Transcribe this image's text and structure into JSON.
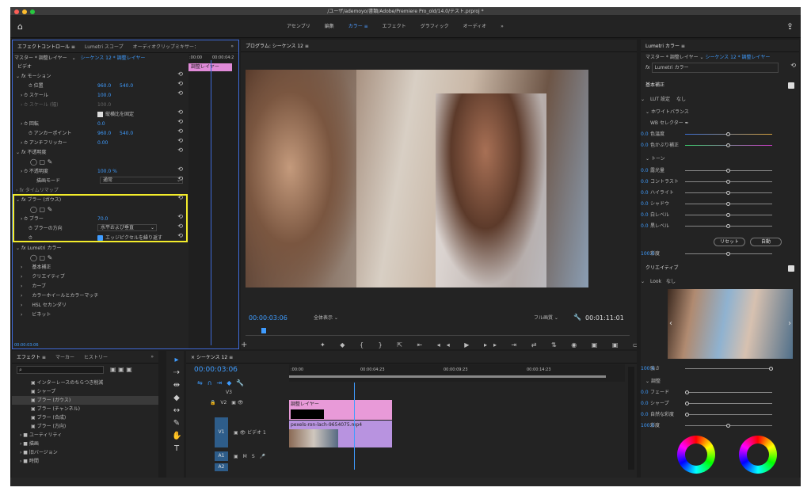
{
  "window": {
    "title": "/ユーザ/ademoyo/書類/Adobe/Premiere Pro_old/14.0/テスト.prproj *"
  },
  "workspace": {
    "tabs": [
      "アセンブリ",
      "編集",
      "カラー",
      "エフェクト",
      "グラフィック",
      "オーディオ"
    ],
    "active": "カラー",
    "more": "»"
  },
  "effect_controls": {
    "tabs": [
      "エフェクトコントロール",
      "Lumetri スコープ",
      "オーディオクリップミキサー："
    ],
    "header": {
      "master": "マスター * 調整レイヤー",
      "seq": "シーケンス 12 * 調整レイヤー",
      "time_start": ":00:00",
      "time_end": "00:00:04:2",
      "clip_label": "調整レイヤー"
    },
    "video_label": "ビデオ",
    "motion": {
      "name": "モーション",
      "pos_label": "位置",
      "pos_x": "960.0",
      "pos_y": "540.0",
      "scale_label": "スケール",
      "scale": "100.0",
      "scalew_label": "スケール (幅)",
      "lock_label": "縦横比を固定",
      "rot_label": "回転",
      "rot": "0.0",
      "anchor_label": "アンカーポイント",
      "anc_x": "960.0",
      "anc_y": "540.0",
      "flicker_label": "アンチフリッカー",
      "flicker": "0.00"
    },
    "opacity": {
      "name": "不透明度",
      "label": "不透明度",
      "value": "100.0 %",
      "blend_label": "描画モード",
      "blend": "通常"
    },
    "remap": "タイムリマップ",
    "blur": {
      "name": "ブラー (ガウス)",
      "label": "ブラー",
      "value": "70.0",
      "dir_label": "ブラーの方向",
      "dir": "水平および垂直",
      "repeat": "エッジピクセルを繰り返す"
    },
    "lumetri": {
      "name": "Lumetri カラー",
      "items": [
        "基本補正",
        "クリエイティブ",
        "カーブ",
        "カラーホイールとカラーマッチ",
        "HSL セカンダリ",
        "ビネット"
      ]
    },
    "timecode": "00:00:03:06"
  },
  "program": {
    "title": "プログラム: シーケンス 12",
    "timecode": "00:00:03:06",
    "fit": "全体表示",
    "quality": "フル画質",
    "duration": "00:01:11:01"
  },
  "effects_panel": {
    "tabs": [
      "エフェクト",
      "マーカー",
      "ヒストリー"
    ],
    "items": [
      "インターレースのちらつき削減",
      "シャープ",
      "ブラー (ガウス)",
      "ブラー (チャンネル)",
      "ブラー (合成)",
      "ブラー (方向)"
    ],
    "folders": [
      "ユーティリティ",
      "描画",
      "旧バージョン",
      "時間"
    ]
  },
  "timeline": {
    "title": "シーケンス 12",
    "timecode": "00:00:03:06",
    "ruler": [
      ":00:00",
      "00:00:04:23",
      "00:00:09:23",
      "00:00:14:23"
    ],
    "tracks": {
      "v3": "V3",
      "v2": "V2",
      "v1": "V1",
      "v1name": "ビデオ 1",
      "a1": "A1",
      "a2": "A2"
    },
    "clip_adjust": "調整レイヤー",
    "clip_video": "pexels-ron-lach-9654075.mp4"
  },
  "lumetri_panel": {
    "title": "Lumetri カラー",
    "master": "マスター * 調整レイヤー",
    "seq": "シーケンス 12 * 調整レイヤー",
    "fx": "Lumetri カラー",
    "basic": "基本補正",
    "lut_label": "LUT 設定",
    "lut": "なし",
    "wb": "ホワイトバランス",
    "wb_selector": "WB セレクター",
    "temp_label": "色温度",
    "temp": "0.0",
    "tint_label": "色かぶり補正",
    "tint": "0.0",
    "tone": "トーン",
    "tones": [
      {
        "label": "露光量",
        "value": "0.0"
      },
      {
        "label": "コントラスト",
        "value": "0.0"
      },
      {
        "label": "ハイライト",
        "value": "0.0"
      },
      {
        "label": "シャドウ",
        "value": "0.0"
      },
      {
        "label": "白レベル",
        "value": "0.0"
      },
      {
        "label": "黒レベル",
        "value": "0.0"
      }
    ],
    "reset": "リセット",
    "auto": "自動",
    "sat_label": "彩度",
    "sat": "100.0",
    "creative": "クリエイティブ",
    "look_label": "Look",
    "look": "なし",
    "intensity_label": "強さ",
    "intensity": "100.0",
    "adjust": "調整",
    "adj": [
      {
        "label": "フェード",
        "value": "0.0"
      },
      {
        "label": "シャープ",
        "value": "0.0"
      },
      {
        "label": "自然な彩度",
        "value": "0.0"
      },
      {
        "label": "彩度",
        "value": "100.0"
      }
    ]
  },
  "colors": {
    "accent": "#3f9cff",
    "highlight": "#f3ec2b",
    "clip_purple": "#cf93e6",
    "clip_pink": "#e89ad8"
  }
}
